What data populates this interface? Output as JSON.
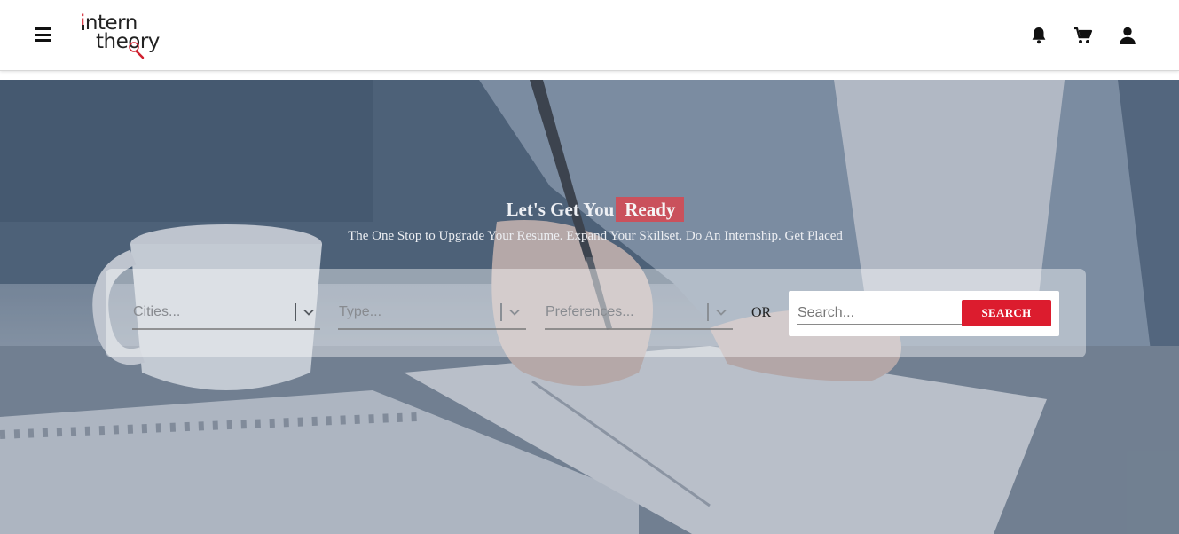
{
  "header": {
    "logo_line1_i": "i",
    "logo_line1_rest": "ntern",
    "logo_line2": "theory",
    "icons": [
      "menu-icon",
      "bell-icon",
      "cart-icon",
      "user-icon"
    ]
  },
  "hero": {
    "headline_prefix": "Let's Get You",
    "headline_highlight": "Ready",
    "subline": "The One Stop to Upgrade Your Resume. Expand Your Skillset. Do An Internship. Get Placed"
  },
  "search": {
    "cities_placeholder": "Cities...",
    "type_placeholder": "Type...",
    "preferences_placeholder": "Preferences...",
    "or_label": "OR",
    "search_placeholder": "Search...",
    "search_value": "",
    "search_button": "SEARCH"
  },
  "colors": {
    "accent": "#dc1c2e",
    "highlight": "#d84650",
    "header_bg": "#ffffff"
  }
}
